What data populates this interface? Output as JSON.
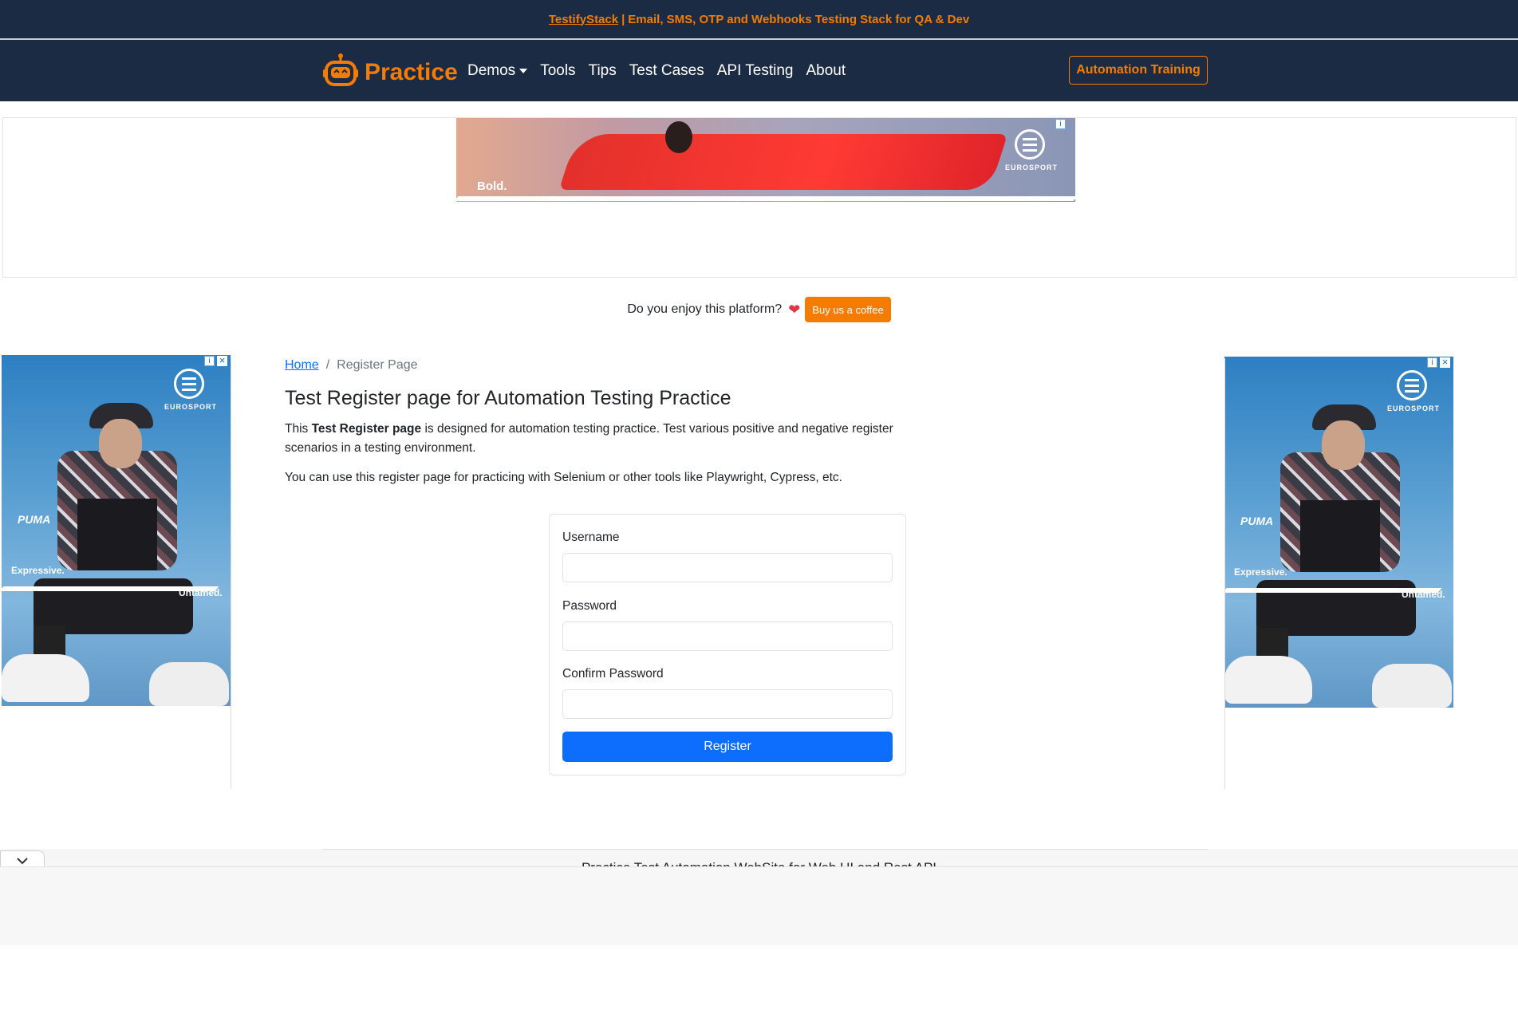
{
  "announcement": {
    "link": "TestifyStack",
    "separator": "|",
    "text": "Email, SMS, OTP and Webhooks Testing Stack for QA & Dev"
  },
  "navbar": {
    "brand": "Practice",
    "links": [
      "Demos",
      "Tools",
      "Tips",
      "Test Cases",
      "API Testing",
      "About"
    ],
    "cta": "Automation Training",
    "brand_color": "#f57c00",
    "bg_color": "#1b2b44"
  },
  "ads": {
    "top_caption": "Bold.",
    "brand": "EUROSPORT",
    "side_brand": "PUMA",
    "side_caption_1": "Expressive.",
    "side_caption_2": "Untamed."
  },
  "support": {
    "text": "Do you enjoy this platform?",
    "button": "Buy us a coffee"
  },
  "breadcrumb": {
    "home": "Home",
    "divider": "/",
    "current": "Register Page"
  },
  "page": {
    "title": "Test Register page for Automation Testing Practice",
    "intro_pre": "This ",
    "intro_bold": "Test Register page",
    "intro_post": " is designed for automation testing practice. Test various positive and negative register scenarios in a testing environment.",
    "intro2": "You can use this register page for practicing with Selenium or other tools like Playwright, Cypress, etc."
  },
  "form": {
    "username_label": "Username",
    "username_value": "",
    "password_label": "Password",
    "password_value": "",
    "confirm_label": "Confirm Password",
    "confirm_value": "",
    "submit": "Register",
    "submit_color": "#0d6efd"
  },
  "footer": {
    "text": "Practice Test Automation WebSite for Web UI and Rest API"
  }
}
